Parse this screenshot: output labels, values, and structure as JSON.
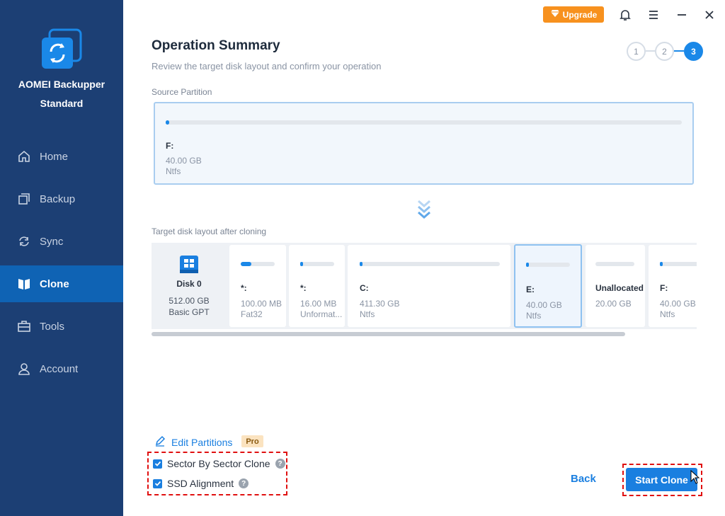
{
  "app": {
    "name": "AOMEI Backupper",
    "edition": "Standard"
  },
  "topbar": {
    "upgrade_label": "Upgrade",
    "icons": [
      "diamond-icon",
      "bell-icon",
      "menu-icon",
      "minimize-icon",
      "close-icon"
    ]
  },
  "sidebar": {
    "items": [
      {
        "label": "Home",
        "icon": "home-icon"
      },
      {
        "label": "Backup",
        "icon": "backup-icon"
      },
      {
        "label": "Sync",
        "icon": "sync-icon"
      },
      {
        "label": "Clone",
        "icon": "clone-icon",
        "active": true
      },
      {
        "label": "Tools",
        "icon": "tools-icon"
      },
      {
        "label": "Account",
        "icon": "account-icon"
      }
    ]
  },
  "header": {
    "title": "Operation Summary",
    "subtitle": "Review the target disk layout and confirm your operation",
    "steps": [
      "1",
      "2",
      "3"
    ],
    "current_step": 3
  },
  "source": {
    "label": "Source Partition",
    "partition": {
      "name": "F:",
      "size": "40.00 GB",
      "fs": "Ntfs",
      "used_fraction": 0.003
    }
  },
  "target": {
    "label": "Target disk layout after cloning",
    "disk": {
      "name": "Disk 0",
      "size": "512.00 GB",
      "type": "Basic GPT"
    },
    "partitions": [
      {
        "name": "*:",
        "size": "100.00 MB",
        "fs": "Fat32",
        "used_fraction": 0.3
      },
      {
        "name": "*:",
        "size": "16.00 MB",
        "fs": "Unformat...",
        "used_fraction": 0.05
      },
      {
        "name": "C:",
        "size": "411.30 GB",
        "fs": "Ntfs",
        "used_fraction": 0.01
      },
      {
        "name": "E:",
        "size": "40.00 GB",
        "fs": "Ntfs",
        "used_fraction": 0.03,
        "selected": true
      },
      {
        "name": "Unallocated",
        "size": "20.00 GB",
        "fs": "",
        "used_fraction": 0
      },
      {
        "name": "F:",
        "size": "40.00 GB",
        "fs": "Ntfs",
        "used_fraction": 0.03
      }
    ]
  },
  "options": {
    "edit_partitions_label": "Edit Partitions",
    "pro_badge": "Pro",
    "sector_by_sector": {
      "label": "Sector By Sector Clone",
      "checked": true
    },
    "ssd_alignment": {
      "label": "SSD Alignment",
      "checked": true
    },
    "help_glyph": "?"
  },
  "footer": {
    "back_label": "Back",
    "start_label": "Start Clone"
  },
  "colors": {
    "sidebar": "#1c3f74",
    "active_nav": "#0f63b4",
    "accent": "#1a7fe0",
    "upgrade": "#f7911e",
    "highlight": "#e01010"
  }
}
